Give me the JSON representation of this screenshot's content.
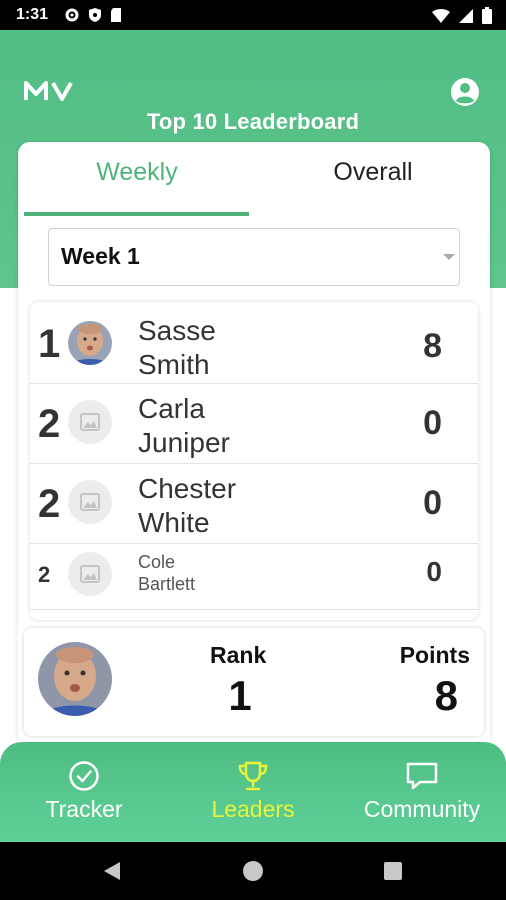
{
  "status_bar": {
    "time": "1:31"
  },
  "header": {
    "title": "Top 10 Leaderboard"
  },
  "tabs": [
    {
      "label": "Weekly",
      "active": true
    },
    {
      "label": "Overall",
      "active": false
    }
  ],
  "week_select": {
    "value": "Week 1"
  },
  "leaderboard": [
    {
      "rank": "1",
      "first": "Sasse",
      "last": "Smith",
      "points": "8",
      "avatar": "photo"
    },
    {
      "rank": "2",
      "first": "Carla",
      "last": "Juniper",
      "points": "0",
      "avatar": "placeholder"
    },
    {
      "rank": "2",
      "first": "Chester",
      "last": "White",
      "points": "0",
      "avatar": "placeholder"
    },
    {
      "rank": "2",
      "first": "Cole",
      "last": "Bartlett",
      "points": "0",
      "avatar": "placeholder"
    }
  ],
  "my_stats": {
    "rank_label": "Rank",
    "rank_value": "1",
    "points_label": "Points",
    "points_value": "8"
  },
  "bottom_nav": [
    {
      "label": "Tracker",
      "icon": "check-circle-icon",
      "active": false
    },
    {
      "label": "Leaders",
      "icon": "trophy-icon",
      "active": true
    },
    {
      "label": "Community",
      "icon": "chat-bubble-icon",
      "active": false
    }
  ],
  "colors": {
    "brand_green": "#51be84",
    "active_tab": "#4fb37a",
    "active_nav": "#e8f33b"
  }
}
